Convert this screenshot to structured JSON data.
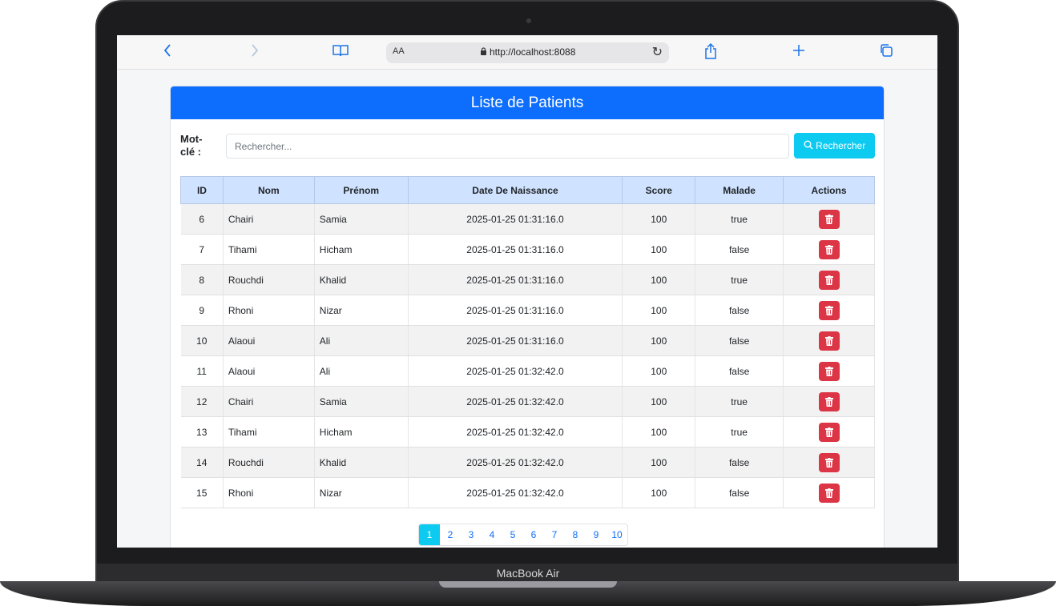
{
  "device": {
    "label": "MacBook Air"
  },
  "browser": {
    "address_aa": "AA",
    "url": "http://localhost:8088"
  },
  "page": {
    "title": "Liste de Patients",
    "search": {
      "label": "Mot-clé :",
      "placeholder": "Rechercher...",
      "value": "",
      "button_label": "Rechercher"
    },
    "table": {
      "headers": [
        "ID",
        "Nom",
        "Prénom",
        "Date De Naissance",
        "Score",
        "Malade",
        "Actions"
      ],
      "rows": [
        {
          "id": "6",
          "nom": "Chairi",
          "prenom": "Samia",
          "date": "2025-01-25 01:31:16.0",
          "score": "100",
          "malade": "true"
        },
        {
          "id": "7",
          "nom": "Tihami",
          "prenom": "Hicham",
          "date": "2025-01-25 01:31:16.0",
          "score": "100",
          "malade": "false"
        },
        {
          "id": "8",
          "nom": "Rouchdi",
          "prenom": "Khalid",
          "date": "2025-01-25 01:31:16.0",
          "score": "100",
          "malade": "true"
        },
        {
          "id": "9",
          "nom": "Rhoni",
          "prenom": "Nizar",
          "date": "2025-01-25 01:31:16.0",
          "score": "100",
          "malade": "false"
        },
        {
          "id": "10",
          "nom": "Alaoui",
          "prenom": "Ali",
          "date": "2025-01-25 01:31:16.0",
          "score": "100",
          "malade": "false"
        },
        {
          "id": "11",
          "nom": "Alaoui",
          "prenom": "Ali",
          "date": "2025-01-25 01:32:42.0",
          "score": "100",
          "malade": "false"
        },
        {
          "id": "12",
          "nom": "Chairi",
          "prenom": "Samia",
          "date": "2025-01-25 01:32:42.0",
          "score": "100",
          "malade": "true"
        },
        {
          "id": "13",
          "nom": "Tihami",
          "prenom": "Hicham",
          "date": "2025-01-25 01:32:42.0",
          "score": "100",
          "malade": "true"
        },
        {
          "id": "14",
          "nom": "Rouchdi",
          "prenom": "Khalid",
          "date": "2025-01-25 01:32:42.0",
          "score": "100",
          "malade": "false"
        },
        {
          "id": "15",
          "nom": "Rhoni",
          "prenom": "Nizar",
          "date": "2025-01-25 01:32:42.0",
          "score": "100",
          "malade": "false"
        }
      ],
      "row_action_icon": "trash-icon"
    },
    "pagination": {
      "pages": [
        "1",
        "2",
        "3",
        "4",
        "5",
        "6",
        "7",
        "8",
        "9",
        "10"
      ],
      "current": "1"
    }
  },
  "colors": {
    "header_blue": "#0d6efd",
    "info_cyan": "#0dcaf0",
    "danger_red": "#dc3545",
    "table_head": "#cfe2ff"
  }
}
